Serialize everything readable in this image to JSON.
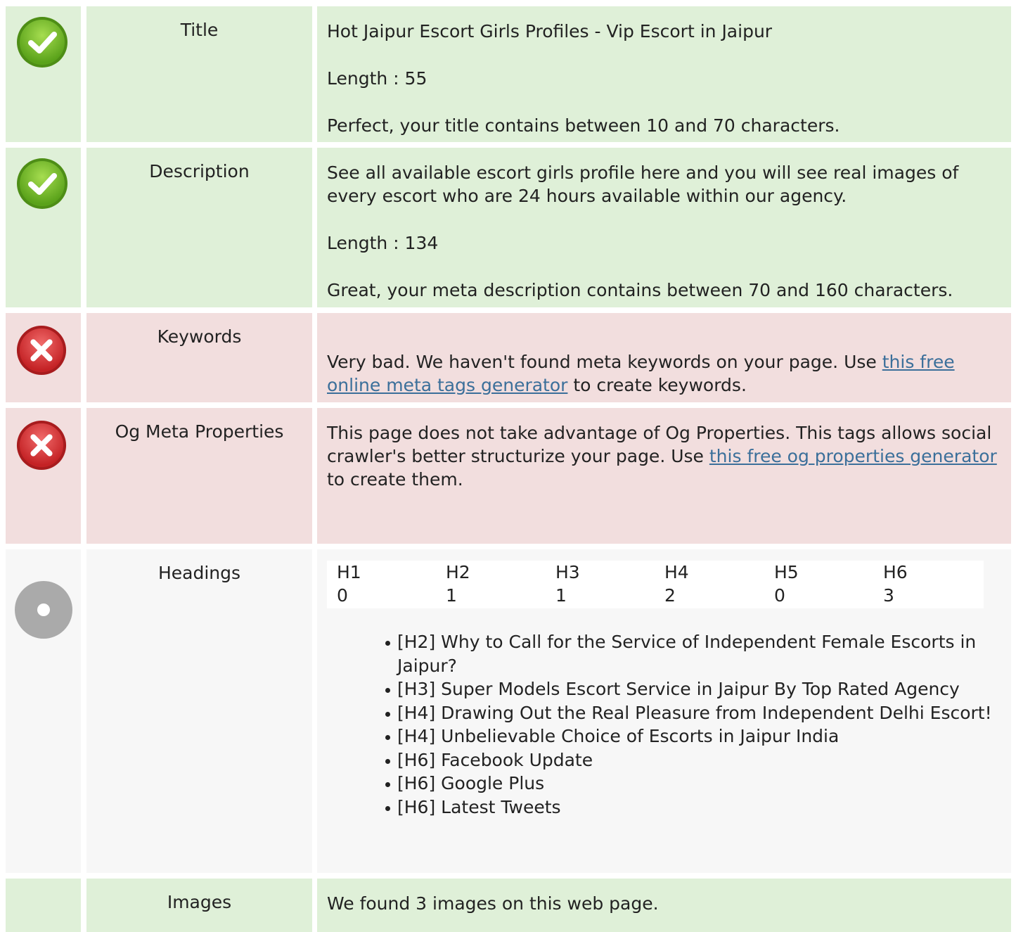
{
  "rows": {
    "title": {
      "name": "Title",
      "value": "Hot Jaipur Escort Girls Profiles - Vip Escort in Jaipur",
      "length": "Length : 55",
      "message": "Perfect, your title contains between 10 and 70 characters.",
      "status": "good"
    },
    "description": {
      "name": "Description",
      "value": "See all available escort girls profile here and you will see real images of every escort who are 24 hours available within our agency.",
      "length": "Length : 134",
      "message": "Great, your meta description contains between 70 and 160 characters.",
      "status": "good"
    },
    "keywords": {
      "name": "Keywords",
      "message_pre": "Very bad. We haven't found meta keywords on your page. Use ",
      "link": "this free online meta tags generator",
      "message_post": " to create keywords.",
      "status": "bad"
    },
    "og": {
      "name": "Og Meta Properties",
      "message_pre": "This page does not take advantage of Og Properties. This tags allows social crawler's better structurize your page. Use ",
      "link": "this free og properties generator",
      "message_post": " to create them.",
      "status": "bad"
    },
    "headings": {
      "name": "Headings",
      "status": "neutral",
      "table": [
        {
          "label": "H1",
          "count": "0"
        },
        {
          "label": "H2",
          "count": "1"
        },
        {
          "label": "H3",
          "count": "1"
        },
        {
          "label": "H4",
          "count": "2"
        },
        {
          "label": "H5",
          "count": "0"
        },
        {
          "label": "H6",
          "count": "3"
        }
      ],
      "list": [
        "[H2] Why to Call for the Service of Independent Female Escorts in Jaipur?",
        "[H3] Super Models Escort Service in Jaipur By Top Rated Agency",
        "[H4] Drawing Out the Real Pleasure from Independent Delhi Escort!",
        "[H4] Unbelievable Choice of Escorts in Jaipur India",
        "[H6] Facebook Update",
        "[H6] Google Plus",
        "[H6] Latest Tweets"
      ]
    },
    "images": {
      "name": "Images",
      "message": "We found 3 images on this web page."
    }
  },
  "colors": {
    "good_bg": "#dff0d8",
    "bad_bg": "#f2dede",
    "neutral_bg": "#f7f7f7",
    "link": "#3b6f9a",
    "check_icon": "#7cb82f",
    "error_icon": "#d9393b",
    "neutral_icon": "#aaaaaa"
  },
  "icons": {
    "good": "check-circle-icon",
    "bad": "error-x-circle-icon",
    "neutral": "info-dot-circle-icon"
  }
}
